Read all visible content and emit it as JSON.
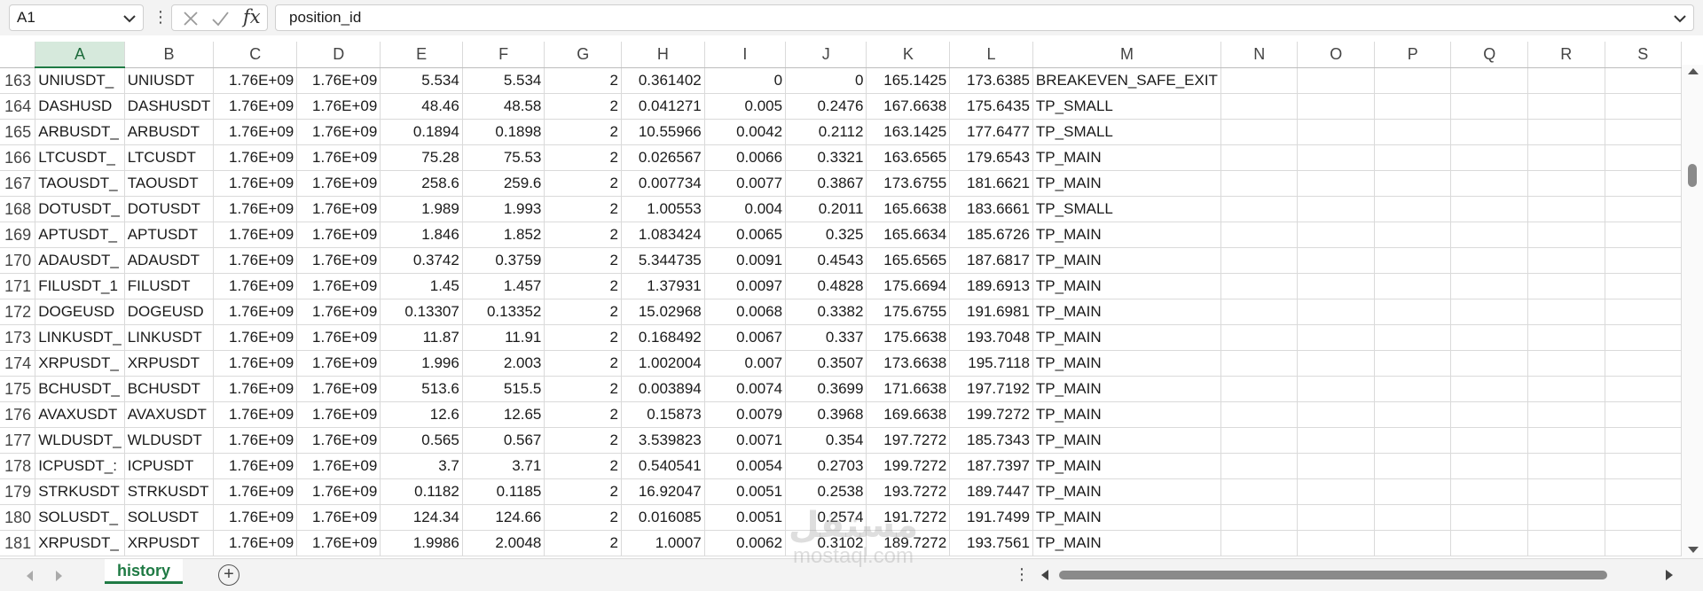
{
  "formula_bar": {
    "name_box": "A1",
    "formula": "position_id",
    "fx_label": "fx"
  },
  "columns": [
    "A",
    "B",
    "C",
    "D",
    "E",
    "F",
    "G",
    "H",
    "I",
    "J",
    "K",
    "L",
    "M",
    "N",
    "O",
    "P",
    "Q",
    "R",
    "S"
  ],
  "selected_column": "A",
  "rows": [
    {
      "n": "163",
      "A": "UNIUSDT_",
      "B": "UNIUSDT",
      "C": "1.76E+09",
      "D": "1.76E+09",
      "E": "5.534",
      "F": "5.534",
      "G": "2",
      "H": "0.361402",
      "I": "0",
      "J": "0",
      "K": "165.1425",
      "L": "173.6385",
      "M": "BREAKEVEN_SAFE_EXIT"
    },
    {
      "n": "164",
      "A": "DASHUSD",
      "B": "DASHUSDT",
      "C": "1.76E+09",
      "D": "1.76E+09",
      "E": "48.46",
      "F": "48.58",
      "G": "2",
      "H": "0.041271",
      "I": "0.005",
      "J": "0.2476",
      "K": "167.6638",
      "L": "175.6435",
      "M": "TP_SMALL"
    },
    {
      "n": "165",
      "A": "ARBUSDT_",
      "B": "ARBUSDT",
      "C": "1.76E+09",
      "D": "1.76E+09",
      "E": "0.1894",
      "F": "0.1898",
      "G": "2",
      "H": "10.55966",
      "I": "0.0042",
      "J": "0.2112",
      "K": "163.1425",
      "L": "177.6477",
      "M": "TP_SMALL"
    },
    {
      "n": "166",
      "A": "LTCUSDT_",
      "B": "LTCUSDT",
      "C": "1.76E+09",
      "D": "1.76E+09",
      "E": "75.28",
      "F": "75.53",
      "G": "2",
      "H": "0.026567",
      "I": "0.0066",
      "J": "0.3321",
      "K": "163.6565",
      "L": "179.6543",
      "M": "TP_MAIN"
    },
    {
      "n": "167",
      "A": "TAOUSDT_",
      "B": "TAOUSDT",
      "C": "1.76E+09",
      "D": "1.76E+09",
      "E": "258.6",
      "F": "259.6",
      "G": "2",
      "H": "0.007734",
      "I": "0.0077",
      "J": "0.3867",
      "K": "173.6755",
      "L": "181.6621",
      "M": "TP_MAIN"
    },
    {
      "n": "168",
      "A": "DOTUSDT_",
      "B": "DOTUSDT",
      "C": "1.76E+09",
      "D": "1.76E+09",
      "E": "1.989",
      "F": "1.993",
      "G": "2",
      "H": "1.00553",
      "I": "0.004",
      "J": "0.2011",
      "K": "165.6638",
      "L": "183.6661",
      "M": "TP_SMALL"
    },
    {
      "n": "169",
      "A": "APTUSDT_",
      "B": "APTUSDT",
      "C": "1.76E+09",
      "D": "1.76E+09",
      "E": "1.846",
      "F": "1.852",
      "G": "2",
      "H": "1.083424",
      "I": "0.0065",
      "J": "0.325",
      "K": "165.6634",
      "L": "185.6726",
      "M": "TP_MAIN"
    },
    {
      "n": "170",
      "A": "ADAUSDT_",
      "B": "ADAUSDT",
      "C": "1.76E+09",
      "D": "1.76E+09",
      "E": "0.3742",
      "F": "0.3759",
      "G": "2",
      "H": "5.344735",
      "I": "0.0091",
      "J": "0.4543",
      "K": "165.6565",
      "L": "187.6817",
      "M": "TP_MAIN"
    },
    {
      "n": "171",
      "A": "FILUSDT_1",
      "B": "FILUSDT",
      "C": "1.76E+09",
      "D": "1.76E+09",
      "E": "1.45",
      "F": "1.457",
      "G": "2",
      "H": "1.37931",
      "I": "0.0097",
      "J": "0.4828",
      "K": "175.6694",
      "L": "189.6913",
      "M": "TP_MAIN"
    },
    {
      "n": "172",
      "A": "DOGEUSD",
      "B": "DOGEUSD",
      "C": "1.76E+09",
      "D": "1.76E+09",
      "E": "0.13307",
      "F": "0.13352",
      "G": "2",
      "H": "15.02968",
      "I": "0.0068",
      "J": "0.3382",
      "K": "175.6755",
      "L": "191.6981",
      "M": "TP_MAIN"
    },
    {
      "n": "173",
      "A": "LINKUSDT_",
      "B": "LINKUSDT",
      "C": "1.76E+09",
      "D": "1.76E+09",
      "E": "11.87",
      "F": "11.91",
      "G": "2",
      "H": "0.168492",
      "I": "0.0067",
      "J": "0.337",
      "K": "175.6638",
      "L": "193.7048",
      "M": "TP_MAIN"
    },
    {
      "n": "174",
      "A": "XRPUSDT_",
      "B": "XRPUSDT",
      "C": "1.76E+09",
      "D": "1.76E+09",
      "E": "1.996",
      "F": "2.003",
      "G": "2",
      "H": "1.002004",
      "I": "0.007",
      "J": "0.3507",
      "K": "173.6638",
      "L": "195.7118",
      "M": "TP_MAIN"
    },
    {
      "n": "175",
      "A": "BCHUSDT_",
      "B": "BCHUSDT",
      "C": "1.76E+09",
      "D": "1.76E+09",
      "E": "513.6",
      "F": "515.5",
      "G": "2",
      "H": "0.003894",
      "I": "0.0074",
      "J": "0.3699",
      "K": "171.6638",
      "L": "197.7192",
      "M": "TP_MAIN"
    },
    {
      "n": "176",
      "A": "AVAXUSDT",
      "B": "AVAXUSDT",
      "C": "1.76E+09",
      "D": "1.76E+09",
      "E": "12.6",
      "F": "12.65",
      "G": "2",
      "H": "0.15873",
      "I": "0.0079",
      "J": "0.3968",
      "K": "169.6638",
      "L": "199.7272",
      "M": "TP_MAIN"
    },
    {
      "n": "177",
      "A": "WLDUSDT_",
      "B": "WLDUSDT",
      "C": "1.76E+09",
      "D": "1.76E+09",
      "E": "0.565",
      "F": "0.567",
      "G": "2",
      "H": "3.539823",
      "I": "0.0071",
      "J": "0.354",
      "K": "197.7272",
      "L": "185.7343",
      "M": "TP_MAIN"
    },
    {
      "n": "178",
      "A": "ICPUSDT_:",
      "B": "ICPUSDT",
      "C": "1.76E+09",
      "D": "1.76E+09",
      "E": "3.7",
      "F": "3.71",
      "G": "2",
      "H": "0.540541",
      "I": "0.0054",
      "J": "0.2703",
      "K": "199.7272",
      "L": "187.7397",
      "M": "TP_MAIN"
    },
    {
      "n": "179",
      "A": "STRKUSDT",
      "B": "STRKUSDT",
      "C": "1.76E+09",
      "D": "1.76E+09",
      "E": "0.1182",
      "F": "0.1185",
      "G": "2",
      "H": "16.92047",
      "I": "0.0051",
      "J": "0.2538",
      "K": "193.7272",
      "L": "189.7447",
      "M": "TP_MAIN"
    },
    {
      "n": "180",
      "A": "SOLUSDT_",
      "B": "SOLUSDT",
      "C": "1.76E+09",
      "D": "1.76E+09",
      "E": "124.34",
      "F": "124.66",
      "G": "2",
      "H": "0.016085",
      "I": "0.0051",
      "J": "0.2574",
      "K": "191.7272",
      "L": "191.7499",
      "M": "TP_MAIN"
    },
    {
      "n": "181",
      "A": "XRPUSDT_",
      "B": "XRPUSDT",
      "C": "1.76E+09",
      "D": "1.76E+09",
      "E": "1.9986",
      "F": "2.0048",
      "G": "2",
      "H": "1.0007",
      "I": "0.0062",
      "J": "0.3102",
      "K": "189.7272",
      "L": "193.7561",
      "M": "TP_MAIN"
    }
  ],
  "text_columns": [
    "A",
    "B",
    "M"
  ],
  "sheet_tabs": [
    {
      "label": "history",
      "active": true
    }
  ],
  "watermark": {
    "arabic": "مستقل",
    "latin": "mostaql.com"
  },
  "colors": {
    "accent": "#1f7a44",
    "selected_header": "#d6e9dc"
  },
  "icons": {
    "name_box_dropdown": "chevron-down-icon",
    "cancel": "close-icon",
    "enter": "checkmark-icon",
    "function": "fx-icon",
    "add_sheet": "plus-circle-icon"
  }
}
